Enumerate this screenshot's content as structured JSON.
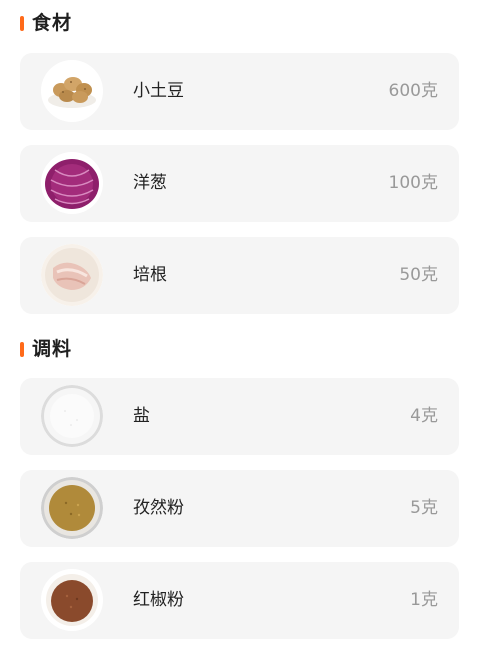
{
  "sections": [
    {
      "title": "食材",
      "items": [
        {
          "name": "小土豆",
          "qty": "600克",
          "icon": "potato-icon"
        },
        {
          "name": "洋葱",
          "qty": "100克",
          "icon": "onion-icon"
        },
        {
          "name": "培根",
          "qty": "50克",
          "icon": "bacon-icon"
        }
      ]
    },
    {
      "title": "调料",
      "items": [
        {
          "name": "盐",
          "qty": "4克",
          "icon": "salt-icon"
        },
        {
          "name": "孜然粉",
          "qty": "5克",
          "icon": "cumin-powder-icon"
        },
        {
          "name": "红椒粉",
          "qty": "1克",
          "icon": "paprika-powder-icon"
        }
      ]
    }
  ],
  "colors": {
    "accent": "#ff6a1a",
    "card_bg": "#f5f5f5",
    "name_text": "#222222",
    "qty_text": "#999999"
  }
}
